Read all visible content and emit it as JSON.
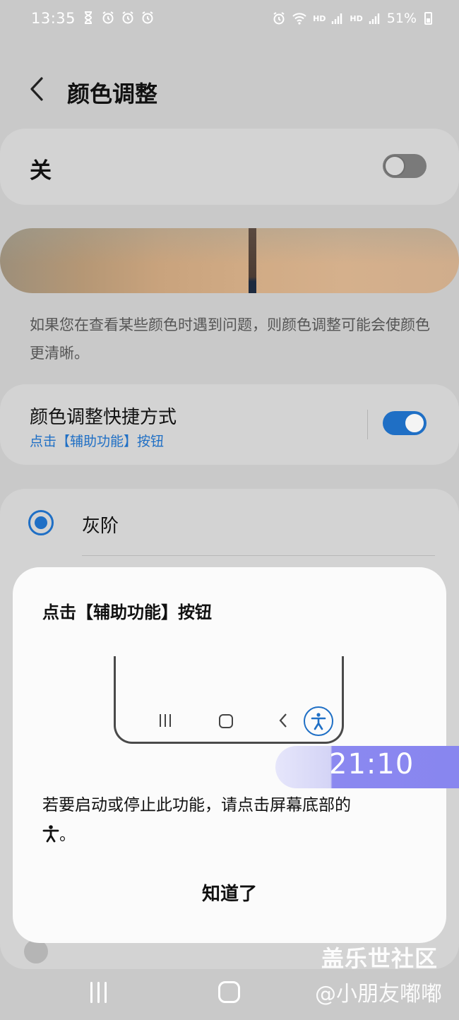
{
  "status_bar": {
    "time": "13:35",
    "left_icons": [
      "hourglass-icon",
      "alarm-icon",
      "alarm-icon",
      "alarm-icon"
    ],
    "right_icons": [
      "alarm-icon",
      "wifi-icon",
      "hd-5g-signal-icon",
      "hd-4g-signal-icon"
    ],
    "net1": "HD",
    "net2": "HD",
    "battery": "51%"
  },
  "header": {
    "title": "颜色调整"
  },
  "master_switch": {
    "label": "关",
    "state": "off"
  },
  "description": "如果您在查看某些颜色时遇到问题，则颜色调整可能会使颜色更清晰。",
  "shortcut": {
    "title": "颜色调整快捷方式",
    "subtitle": "点击【辅助功能】按钮",
    "state": "on"
  },
  "options": [
    {
      "label": "灰阶",
      "selected": true
    }
  ],
  "dialog": {
    "title": "点击【辅助功能】按钮",
    "body": "若要启动或停止此功能，请点击屏幕底部的",
    "body_end": "。",
    "confirm_label": "知道了"
  },
  "overlay_clock": "21:10",
  "watermark": {
    "line1": "盖乐世社区",
    "line2": "@小朋友嘟嘟"
  },
  "colors": {
    "accent": "#1f6fc5",
    "scrim": "#c9c9c9",
    "dialog": "#fbfbfb",
    "clock_bubble": "#8886ef"
  }
}
